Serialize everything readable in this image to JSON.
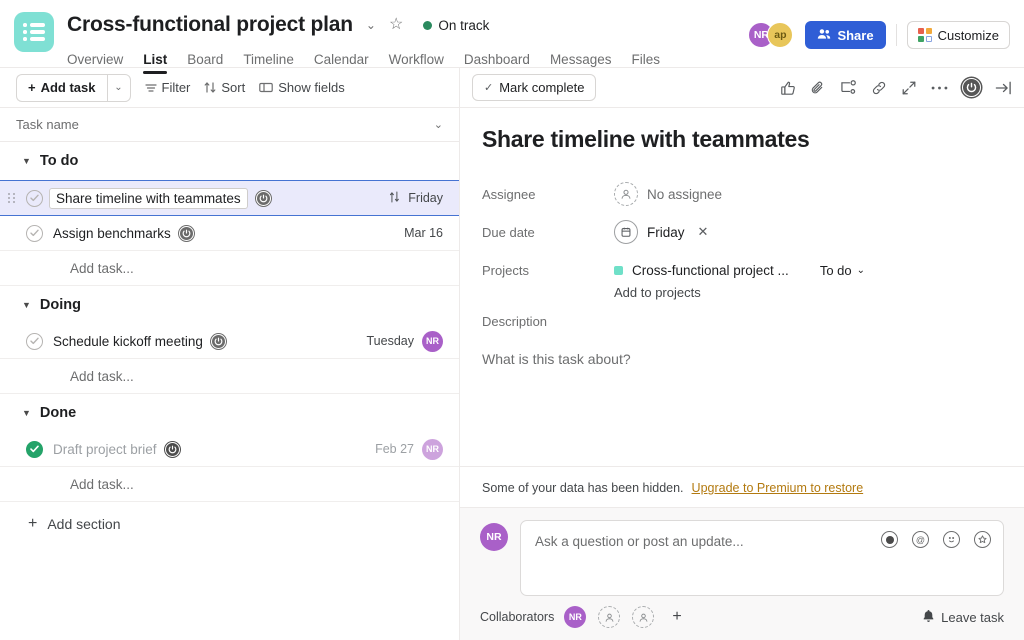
{
  "header": {
    "logo_icon": "list-logo-icon",
    "project_title": "Cross-functional project plan",
    "title_chevron": "⌄",
    "star_icon": "☆",
    "status_label": "On track",
    "status_color": "#2b8a5f",
    "tabs": [
      {
        "label": "Overview",
        "active": false
      },
      {
        "label": "List",
        "active": true
      },
      {
        "label": "Board",
        "active": false
      },
      {
        "label": "Timeline",
        "active": false
      },
      {
        "label": "Calendar",
        "active": false
      },
      {
        "label": "Workflow",
        "active": false
      },
      {
        "label": "Dashboard",
        "active": false
      },
      {
        "label": "Messages",
        "active": false
      },
      {
        "label": "Files",
        "active": false
      }
    ],
    "avatars": [
      {
        "initials": "NR",
        "color": "#a960c8"
      },
      {
        "initials": "ap",
        "color": "#e8c65a"
      }
    ],
    "share_label": "Share",
    "customize_label": "Customize"
  },
  "list_toolbar": {
    "add_task_label": "Add task",
    "add_task_plus": "+",
    "add_task_caret": "⌄",
    "filter_label": "Filter",
    "sort_label": "Sort",
    "show_fields_label": "Show fields"
  },
  "list_columns": {
    "task_name": "Task name",
    "collapse_caret": "⌄"
  },
  "sections": [
    {
      "name": "To do",
      "caret": "▼",
      "tasks": [
        {
          "name": "Share timeline with teammates",
          "selected": true,
          "completed": false,
          "due": "Friday",
          "has_sort_arrows": true,
          "assignee": null,
          "clock_badge": true
        },
        {
          "name": "Assign benchmarks",
          "selected": false,
          "completed": false,
          "due": "Mar 16",
          "has_sort_arrows": false,
          "assignee": null,
          "clock_badge": true
        }
      ],
      "add_task_label": "Add task..."
    },
    {
      "name": "Doing",
      "caret": "▼",
      "tasks": [
        {
          "name": "Schedule kickoff meeting",
          "selected": false,
          "completed": false,
          "due": "Tuesday",
          "has_sort_arrows": false,
          "assignee": "NR",
          "clock_badge": true
        }
      ],
      "add_task_label": "Add task..."
    },
    {
      "name": "Done",
      "caret": "▼",
      "tasks": [
        {
          "name": "Draft project brief",
          "selected": false,
          "completed": true,
          "due": "Feb 27",
          "has_sort_arrows": false,
          "assignee": "NR",
          "clock_badge": true
        }
      ],
      "add_task_label": "Add task..."
    }
  ],
  "add_section_label": "Add section",
  "add_section_plus": "+",
  "detail": {
    "mark_complete_label": "Mark complete",
    "mark_complete_check": "✓",
    "toolbar_icons": [
      "thumbs-up-icon",
      "paperclip-icon",
      "subtask-icon",
      "link-icon",
      "expand-icon",
      "more-options-icon",
      "clock-badge-icon",
      "close-panel-icon"
    ],
    "title": "Share timeline with teammates",
    "fields": {
      "assignee_label": "Assignee",
      "assignee_value": "No assignee",
      "due_date_label": "Due date",
      "due_date_value": "Friday",
      "due_date_clear": "✕",
      "projects_label": "Projects",
      "project_name": "Cross-functional project ...",
      "project_color": "#6fe0c8",
      "project_status": "To do",
      "project_status_caret": "⌄",
      "add_to_projects": "Add to projects",
      "description_label": "Description",
      "description_placeholder": "What is this task about?"
    },
    "upgrade": {
      "message": "Some of your data has been hidden.",
      "link": "Upgrade to Premium to restore"
    },
    "comment": {
      "avatar_initials": "NR",
      "placeholder": "Ask a question or post an update...",
      "icons": [
        "record-icon",
        "mention-icon",
        "emoji-icon",
        "sticker-icon"
      ]
    },
    "collaborators": {
      "label": "Collaborators",
      "avatars": [
        "NR"
      ],
      "empty_slots": 2,
      "add": "+",
      "leave_task_label": "Leave task",
      "bell_icon": "bell-icon"
    }
  }
}
